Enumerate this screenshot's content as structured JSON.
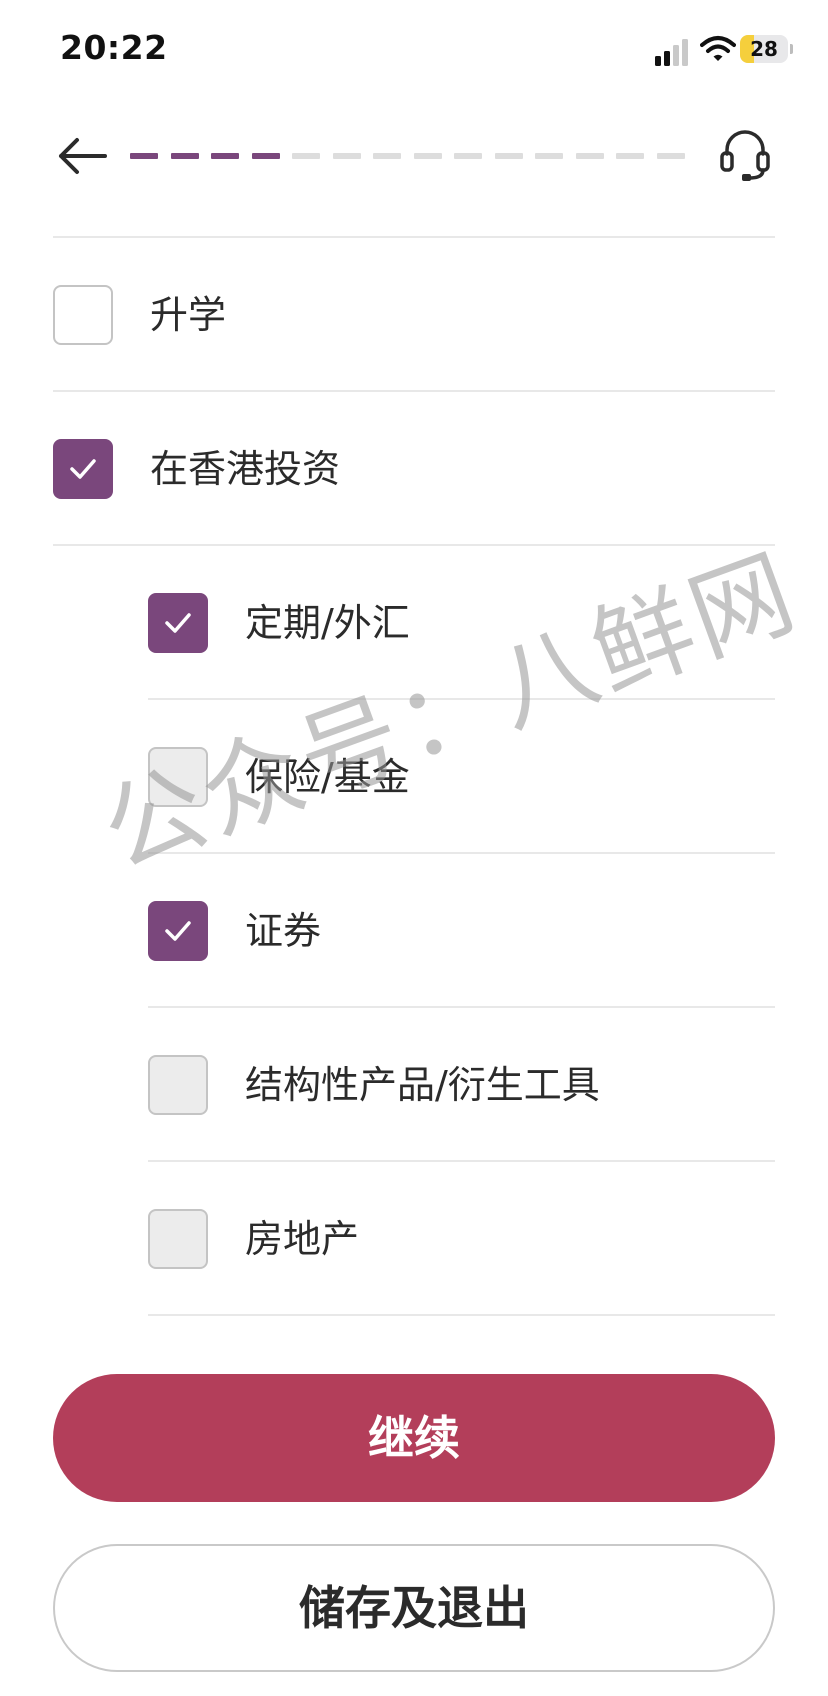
{
  "status_bar": {
    "time": "20:22",
    "battery": "28"
  },
  "header": {
    "back_icon": "arrow-left-icon",
    "support_icon": "headset-icon",
    "progress": {
      "completed_steps": 4,
      "total_steps": 14,
      "active_color": "#7a477c",
      "inactive_color": "#dddddd"
    }
  },
  "options": [
    {
      "label": "升学",
      "checked": false,
      "level": 0
    },
    {
      "label": "在香港投资",
      "checked": true,
      "level": 0
    },
    {
      "label": "定期/外汇",
      "checked": true,
      "level": 1
    },
    {
      "label": "保险/基金",
      "checked": false,
      "level": 1
    },
    {
      "label": "证券",
      "checked": true,
      "level": 1
    },
    {
      "label": "结构性产品/衍生工具",
      "checked": false,
      "level": 1
    },
    {
      "label": "房地产",
      "checked": false,
      "level": 1
    }
  ],
  "watermark": "公众号：八鲜网",
  "buttons": {
    "continue_label": "继续",
    "save_exit_label": "储存及退出"
  },
  "colors": {
    "brand_purple": "#7a477c",
    "primary_button": "#b33e5a"
  }
}
